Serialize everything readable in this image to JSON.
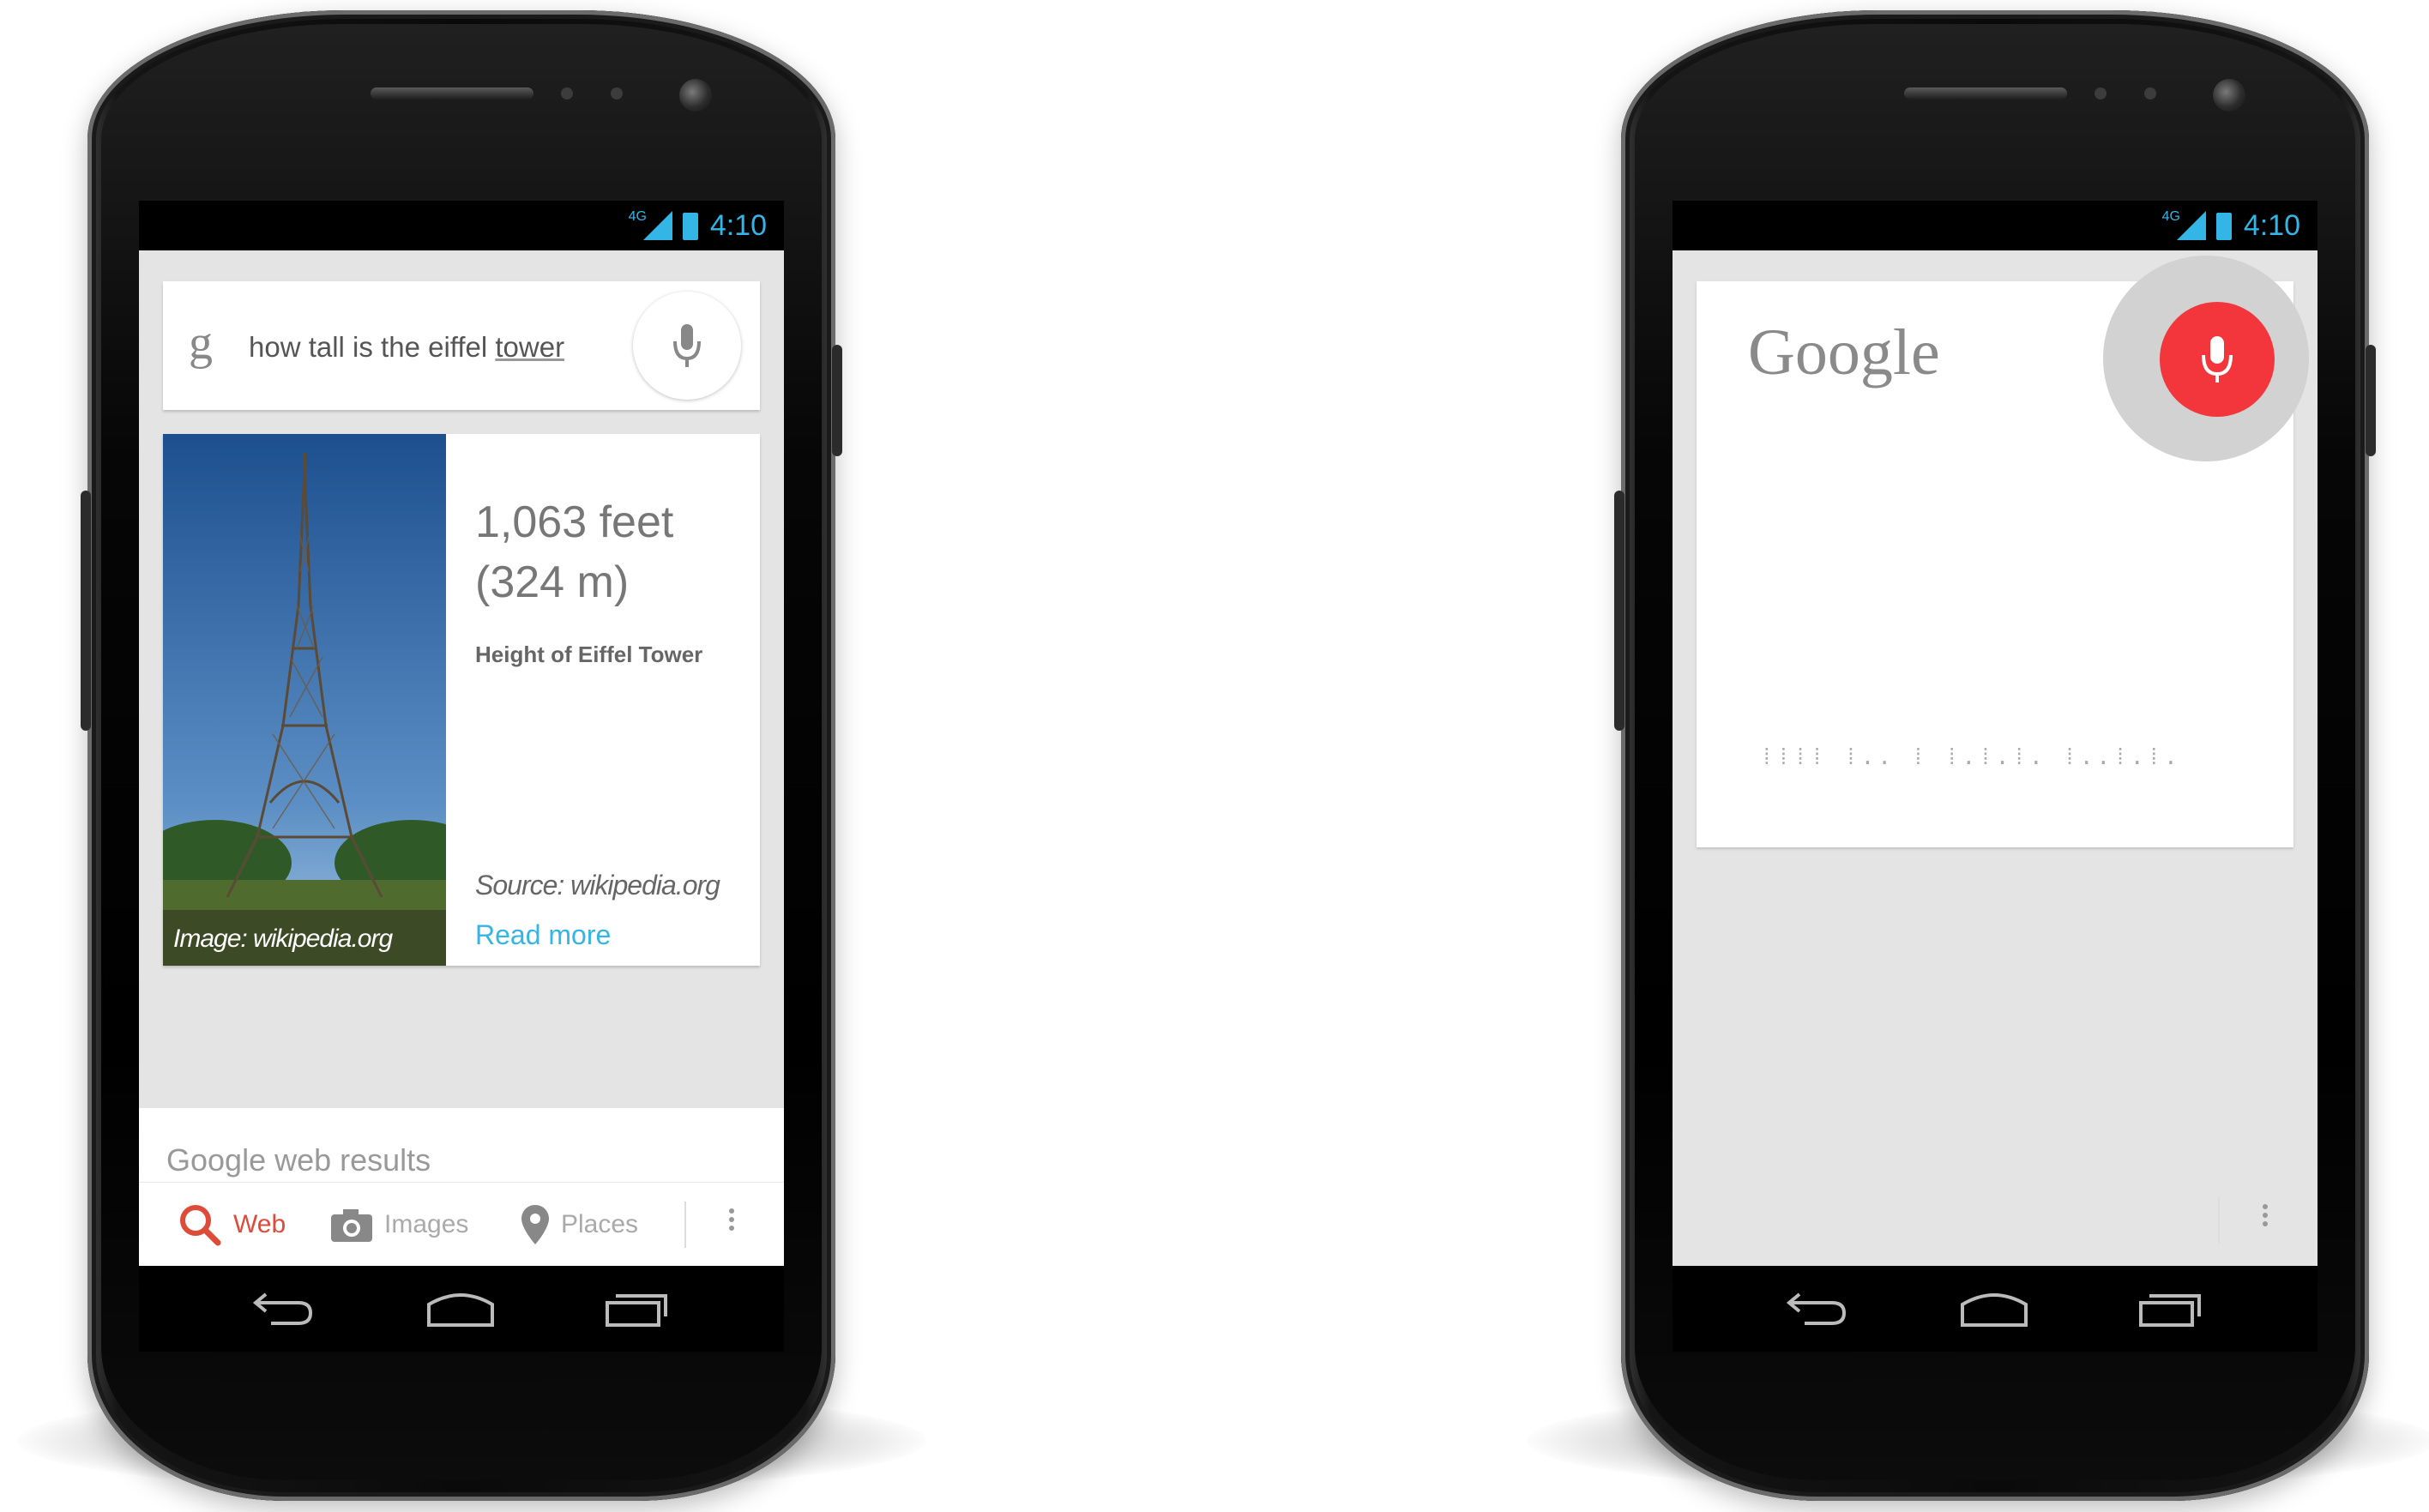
{
  "left_phone": {
    "status_time": "4:10",
    "network_label": "4G",
    "search": {
      "logo": "g",
      "query_prefix": "how tall is the eiffel ",
      "query_suffix": "tower",
      "mic_icon": "mic-icon"
    },
    "answer_card": {
      "image_caption": "Image: wikipedia.org",
      "answer_line1": "1,063 feet",
      "answer_line2": "(324 m)",
      "label": "Height of Eiffel Tower",
      "source": "Source: wikipedia.org",
      "read_more": "Read more"
    },
    "web_results_heading": "Google web results",
    "tabs": [
      {
        "label": "Web",
        "icon": "search-icon",
        "active": true
      },
      {
        "label": "Images",
        "icon": "camera-icon",
        "active": false
      },
      {
        "label": "Places",
        "icon": "map-pin-icon",
        "active": false
      }
    ]
  },
  "right_phone": {
    "status_time": "4:10",
    "network_label": "4G",
    "logo_text": "Google",
    "listening_indicator": "⁞⁞⁞⁞ ⁞.. ⁞ ⁞.⁞.⁞. ⁞..⁞.⁞.",
    "mic_icon": "mic-icon"
  },
  "colors": {
    "accent_blue": "#33b5e5",
    "web_red": "#dd4b39",
    "voice_red": "#f2363c"
  }
}
